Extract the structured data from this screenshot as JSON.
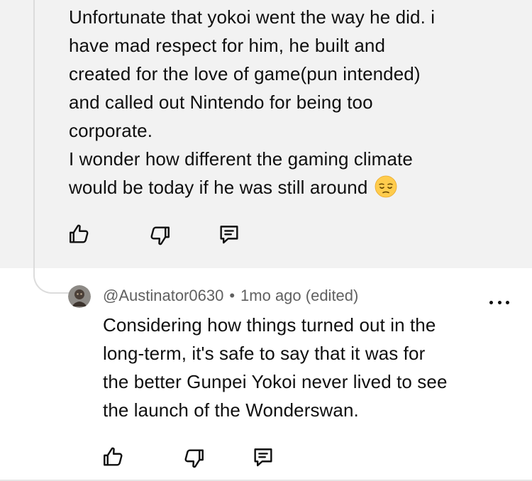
{
  "parent_comment": {
    "text": "Unfortunate that yokoi went the way he did. i\nhave mad respect for him, he built and\ncreated for the love of game(pun intended)\nand called out Nintendo for being too\ncorporate.\nI wonder how different the gaming climate\nwould be today if he was still around",
    "emoji": "pensive-face-emoji",
    "actions": {
      "like_icon": "thumbs-up-icon",
      "dislike_icon": "thumbs-down-icon",
      "reply_icon": "comment-icon"
    }
  },
  "reply": {
    "author": "@Austinator0630",
    "separator": "•",
    "time": "1mo ago (edited)",
    "text": "Considering how things turned out in the\nlong-term, it's safe to say that it was for\nthe better Gunpei Yokoi never lived to see\nthe launch of the Wonderswan.",
    "more_icon": "more-options-icon",
    "actions": {
      "like_icon": "thumbs-up-icon",
      "dislike_icon": "thumbs-down-icon",
      "reply_icon": "comment-icon"
    }
  },
  "colors": {
    "panel_bg": "#f2f2f2",
    "text": "#0f0f0f",
    "meta_text": "#606060",
    "thread_line": "#dcdcdc"
  }
}
